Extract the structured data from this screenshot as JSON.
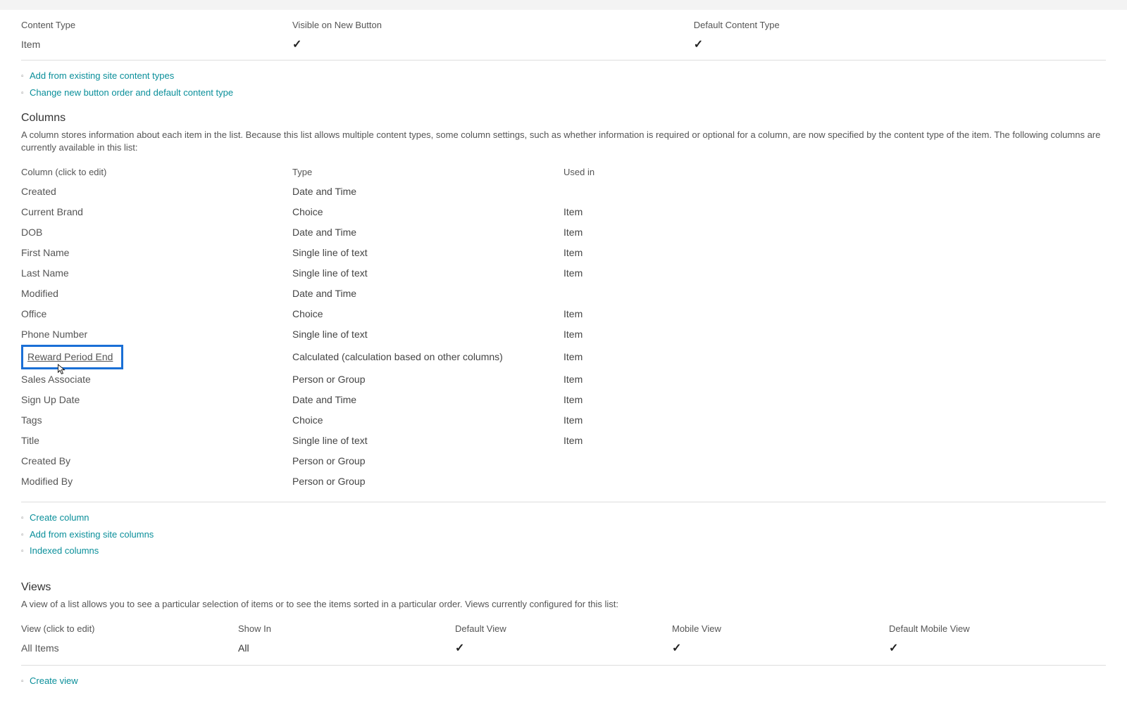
{
  "contentTypes": {
    "headers": {
      "ct": "Content Type",
      "visible": "Visible on New Button",
      "default": "Default Content Type"
    },
    "row": {
      "name": "Item"
    },
    "links": {
      "addExisting": "Add from existing site content types",
      "changeOrder": "Change new button order and default content type"
    }
  },
  "columnsSection": {
    "title": "Columns",
    "desc": "A column stores information about each item in the list. Because this list allows multiple content types, some column settings, such as whether information is required or optional for a column, are now specified by the content type of the item. The following columns are currently available in this list:",
    "headers": {
      "name": "Column (click to edit)",
      "type": "Type",
      "usedIn": "Used in"
    },
    "rows": {
      "0": {
        "name": "Created",
        "type": "Date and Time",
        "usedIn": ""
      },
      "1": {
        "name": "Current Brand",
        "type": "Choice",
        "usedIn": "Item"
      },
      "2": {
        "name": "DOB",
        "type": "Date and Time",
        "usedIn": "Item"
      },
      "3": {
        "name": "First Name",
        "type": "Single line of text",
        "usedIn": "Item"
      },
      "4": {
        "name": "Last Name",
        "type": "Single line of text",
        "usedIn": "Item"
      },
      "5": {
        "name": "Modified",
        "type": "Date and Time",
        "usedIn": ""
      },
      "6": {
        "name": "Office",
        "type": "Choice",
        "usedIn": "Item"
      },
      "7": {
        "name": "Phone Number",
        "type": "Single line of text",
        "usedIn": "Item"
      },
      "8": {
        "name": "Reward Period End",
        "type": "Calculated (calculation based on other columns)",
        "usedIn": "Item"
      },
      "9": {
        "name": "Sales Associate",
        "type": "Person or Group",
        "usedIn": "Item"
      },
      "10": {
        "name": "Sign Up Date",
        "type": "Date and Time",
        "usedIn": "Item"
      },
      "11": {
        "name": "Tags",
        "type": "Choice",
        "usedIn": "Item"
      },
      "12": {
        "name": "Title",
        "type": "Single line of text",
        "usedIn": "Item"
      },
      "13": {
        "name": "Created By",
        "type": "Person or Group",
        "usedIn": ""
      },
      "14": {
        "name": "Modified By",
        "type": "Person or Group",
        "usedIn": ""
      }
    },
    "links": {
      "create": "Create column",
      "addExisting": "Add from existing site columns",
      "indexed": "Indexed columns"
    }
  },
  "viewsSection": {
    "title": "Views",
    "desc": "A view of a list allows you to see a particular selection of items or to see the items sorted in a particular order. Views currently configured for this list:",
    "headers": {
      "view": "View (click to edit)",
      "showIn": "Show In",
      "default": "Default View",
      "mobile": "Mobile View",
      "defaultMobile": "Default Mobile View"
    },
    "row": {
      "name": "All Items",
      "showIn": "All"
    },
    "links": {
      "create": "Create view"
    }
  }
}
